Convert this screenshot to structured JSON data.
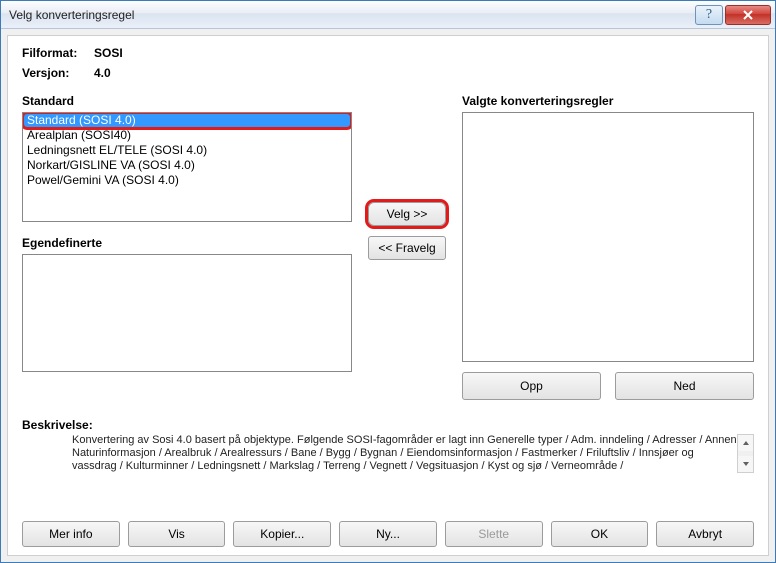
{
  "window": {
    "title": "Velg konverteringsregel"
  },
  "meta": {
    "file_format_label": "Filformat:",
    "file_format_value": "SOSI",
    "version_label": "Versjon:",
    "version_value": "4.0"
  },
  "left": {
    "standard_label": "Standard",
    "standard_items": [
      "Standard (SOSI 4.0)",
      "Arealplan (SOSI40)",
      "Ledningsnett EL/TELE (SOSI 4.0)",
      "Norkart/GISLINE VA (SOSI 4.0)",
      "Powel/Gemini VA (SOSI 4.0)"
    ],
    "standard_selected_index": 0,
    "custom_label": "Egendefinerte"
  },
  "mid": {
    "select_label": "Velg >>",
    "deselect_label": "<< Fravelg"
  },
  "right": {
    "selected_label": "Valgte konverteringsregler",
    "up_label": "Opp",
    "down_label": "Ned"
  },
  "description": {
    "label": "Beskrivelse:",
    "text": "Konvertering av Sosi 4.0 basert på objektype. Følgende SOSI-fagområder er lagt inn Generelle typer / Adm. inndeling / Adresser / Annen Naturinformasjon / Arealbruk / Arealressurs / Bane / Bygg / Bygnan / Eiendomsinformasjon / Fastmerker / Friluftsliv / Innsjøer og vassdrag / Kulturminner / Ledningsnett / Markslag / Terreng / Vegnett / Vegsituasjon / Kyst og sjø / Verneområde /"
  },
  "footer": {
    "more_info": "Mer info",
    "show": "Vis",
    "copy": "Kopier...",
    "new": "Ny...",
    "delete": "Slette",
    "ok": "OK",
    "cancel": "Avbryt"
  }
}
